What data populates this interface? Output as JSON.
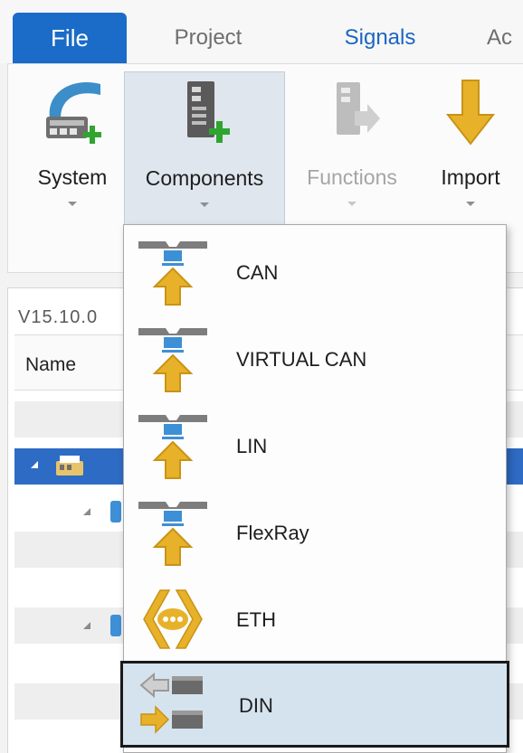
{
  "tabs": {
    "file": "File",
    "project": "Project",
    "signals": "Signals",
    "partial": "Ac"
  },
  "ribbon": {
    "system": {
      "label": "System",
      "icon": "system-add-icon"
    },
    "components": {
      "label": "Components",
      "icon": "component-add-icon"
    },
    "functions": {
      "label": "Functions",
      "icon": "functions-export-icon",
      "disabled": true
    },
    "import": {
      "label": "Import",
      "icon": "import-arrow-icon"
    }
  },
  "workspace": {
    "version": "V15.10.0",
    "column_name": "Name"
  },
  "menu": {
    "items": [
      {
        "label": "CAN",
        "icon": "bus-connector-icon"
      },
      {
        "label": "VIRTUAL CAN",
        "icon": "bus-connector-icon"
      },
      {
        "label": "LIN",
        "icon": "bus-connector-icon"
      },
      {
        "label": "FlexRay",
        "icon": "bus-connector-icon"
      },
      {
        "label": "ETH",
        "icon": "ethernet-icon"
      },
      {
        "label": "DIN",
        "icon": "digital-io-icon",
        "highlighted": true
      }
    ]
  },
  "colors": {
    "file_tab": "#1b6bc8",
    "signals_tab_text": "#1b66c2",
    "selected_row": "#2e6bc4",
    "menu_highlight": "#d5e3ee",
    "icon_yellow": "#e7b22a",
    "icon_blue": "#3d8fd6"
  }
}
